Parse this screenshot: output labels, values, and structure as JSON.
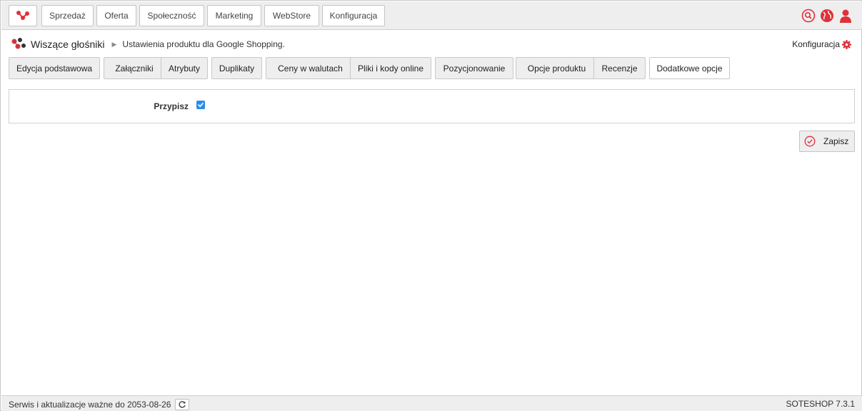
{
  "nav": {
    "items": [
      "Sprzedaż",
      "Oferta",
      "Społeczność",
      "Marketing",
      "WebStore",
      "Konfiguracja"
    ]
  },
  "breadcrumb": {
    "title": "Wiszące głośniki",
    "subtitle": "Ustawienia produktu dla Google Shopping."
  },
  "config_link": "Konfiguracja",
  "tabs": [
    "Edycja podstawowa",
    "Załączniki",
    "Atrybuty",
    "Duplikaty",
    "Ceny w walutach",
    "Pliki i kody online",
    "Pozycjonowanie",
    "Opcje produktu",
    "Recenzje",
    "Dodatkowe opcje"
  ],
  "active_tab": "Dodatkowe opcje",
  "form": {
    "assign_label": "Przypisz",
    "assign_checked": true
  },
  "save_label": "Zapisz",
  "footer": {
    "service_text": "Serwis i aktualizacje ważne do 2053-08-26",
    "version": "SOTESHOP 7.3.1"
  },
  "colors": {
    "accent": "#e0313a",
    "checkbox": "#2a8cf0",
    "bar": "#eeeeee"
  },
  "icons": {
    "logo": "soteshop-logo-icon",
    "search": "search-icon",
    "globe": "globe-icon",
    "user": "user-icon",
    "gear": "gear-icon",
    "save": "check-circle-icon",
    "refresh": "refresh-icon"
  }
}
